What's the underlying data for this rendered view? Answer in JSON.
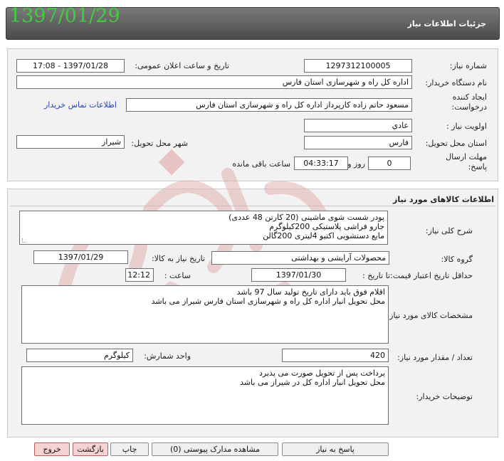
{
  "header": {
    "title": "جزئیات اطلاعات نیاز",
    "date": "1397/01/29"
  },
  "info": {
    "need_number_label": "شماره نیاز:",
    "need_number": "1297312100005",
    "announce_label": "تاریخ و ساعت اعلان عمومی:",
    "announce_value": "1397/01/28 - 17:08",
    "buyer_org_label": "نام دستگاه خریدار:",
    "buyer_org": "اداره کل راه و شهرسازی استان فارس",
    "creator_label": "ایجاد کننده درخواست:",
    "creator": "مسعود حاتم زاده کارپرداز اداره کل راه و شهرسازی استان فارس",
    "contact_link": "اطلاعات تماس خریدار",
    "priority_label": "اولویت نیاز :",
    "priority": "عادي",
    "province_label": "استان محل تحویل:",
    "province": "فارس",
    "city_label": "شهر محل تحویل:",
    "city": "شیراز",
    "deadline_label": "مهلت ارسال پاسخ:",
    "days": "0",
    "days_label": "روز و",
    "time_left": "04:33:17",
    "time_left_label": "ساعت باقی مانده"
  },
  "goods": {
    "section_title": "اطلاعات کالاهای مورد نیاز",
    "summary_label": "شرح کلی نیاز:",
    "summary": "پودر شست شوی ماشینی (20 کارتن 48 عددی)\nجارو فراشی پلاستیکی 200کیلوگرم\nمایع دستشویی اکتیو 4لیتری 200گالن",
    "group_label": "گروه کالا:",
    "group": "محصولات آرایشی و بهداشتی",
    "need_date_label": "تاریخ نیاز به کالا:",
    "need_date": "1397/01/29",
    "min_validity_label": "حداقل تاریخ اعتبار قیمت:",
    "to_date_label": "تا تاریخ :",
    "to_date": "1397/01/30",
    "hour_label": "ساعت :",
    "hour": "12:12",
    "specs_label": "مشخصات کالای مورد نیاز:",
    "specs": "اقلام فوق باید دارای تاریخ تولید سال 97 باشد\nمحل تحویل انبار اداره کل راه و شهرسازی استان فارس شیراز می باشد",
    "qty_label": "تعداد / مقدار مورد نیاز:",
    "qty": "420",
    "unit_label": "واحد شمارش:",
    "unit": "کیلوگرم",
    "buyer_notes_label": "توضیحات خریدار:",
    "buyer_notes": "پرداخت پس از تحویل صورت می پذیرد\nمحل تحویل انبار اداره کل در شیراز می باشد"
  },
  "buttons": {
    "respond": "پاسخ به نیاز",
    "attachments": "مشاهده مدارک پیوستی (0)",
    "print": "چاپ",
    "back": "بازگشت",
    "exit": "خروج"
  },
  "colors": {
    "header_date": "#3ecf3e",
    "link": "#1f44b8",
    "watermark": "#e3b1b1"
  }
}
